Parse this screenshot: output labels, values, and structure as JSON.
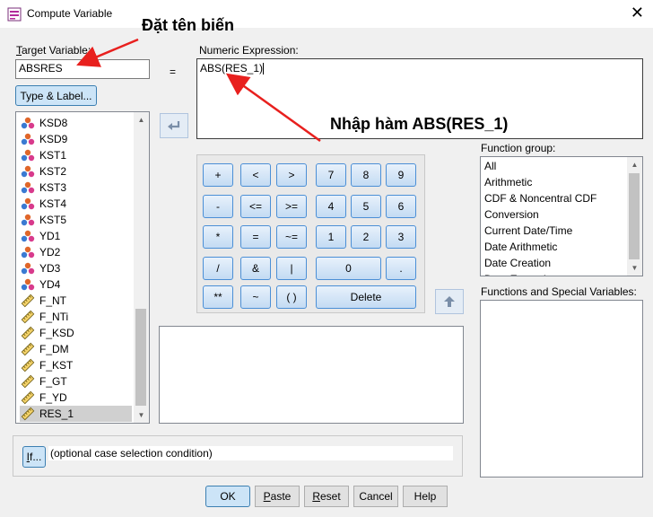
{
  "window": {
    "title": "Compute Variable",
    "close_glyph": "✕"
  },
  "target": {
    "label": "Target Variable:",
    "value": "ABSRES",
    "type_label_button": "Type & Label..."
  },
  "equals": "=",
  "expression": {
    "label": "Numeric Expression:",
    "value": "ABS(RES_1)"
  },
  "variables": [
    {
      "name": "KSD8",
      "type": "nominal"
    },
    {
      "name": "KSD9",
      "type": "nominal"
    },
    {
      "name": "KST1",
      "type": "nominal"
    },
    {
      "name": "KST2",
      "type": "nominal"
    },
    {
      "name": "KST3",
      "type": "nominal"
    },
    {
      "name": "KST4",
      "type": "nominal"
    },
    {
      "name": "KST5",
      "type": "nominal"
    },
    {
      "name": "YD1",
      "type": "nominal"
    },
    {
      "name": "YD2",
      "type": "nominal"
    },
    {
      "name": "YD3",
      "type": "nominal"
    },
    {
      "name": "YD4",
      "type": "nominal"
    },
    {
      "name": "F_NT",
      "type": "scale"
    },
    {
      "name": "F_NTi",
      "type": "scale"
    },
    {
      "name": "F_KSD",
      "type": "scale"
    },
    {
      "name": "F_DM",
      "type": "scale"
    },
    {
      "name": "F_KST",
      "type": "scale"
    },
    {
      "name": "F_GT",
      "type": "scale"
    },
    {
      "name": "F_YD",
      "type": "scale"
    },
    {
      "name": "RES_1",
      "type": "scale",
      "selected": true
    }
  ],
  "keypad": {
    "row1": [
      "+",
      "<",
      ">",
      "7",
      "8",
      "9"
    ],
    "row2": [
      "-",
      "<=",
      ">=",
      "4",
      "5",
      "6"
    ],
    "row3": [
      "*",
      "=",
      "~=",
      "1",
      "2",
      "3"
    ],
    "row4": [
      "/",
      "&",
      "|",
      "0",
      "."
    ],
    "row5": [
      "**",
      "~",
      "( )",
      "Delete"
    ]
  },
  "function_group": {
    "label": "Function group:",
    "items": [
      "All",
      "Arithmetic",
      "CDF & Noncentral CDF",
      "Conversion",
      "Current Date/Time",
      "Date Arithmetic",
      "Date Creation",
      "Date Extraction"
    ]
  },
  "functions_special": {
    "label": "Functions and Special Variables:"
  },
  "if_section": {
    "button": "If...",
    "condition_text": "(optional case selection condition)"
  },
  "bottom_buttons": {
    "ok": "OK",
    "paste": "Paste",
    "reset": "Reset",
    "cancel": "Cancel",
    "help": "Help"
  },
  "annotations": {
    "name_variable": "Đặt tên biến",
    "enter_function": "Nhập hàm ABS(RES_1)",
    "arrow_color": "#e8201e"
  }
}
